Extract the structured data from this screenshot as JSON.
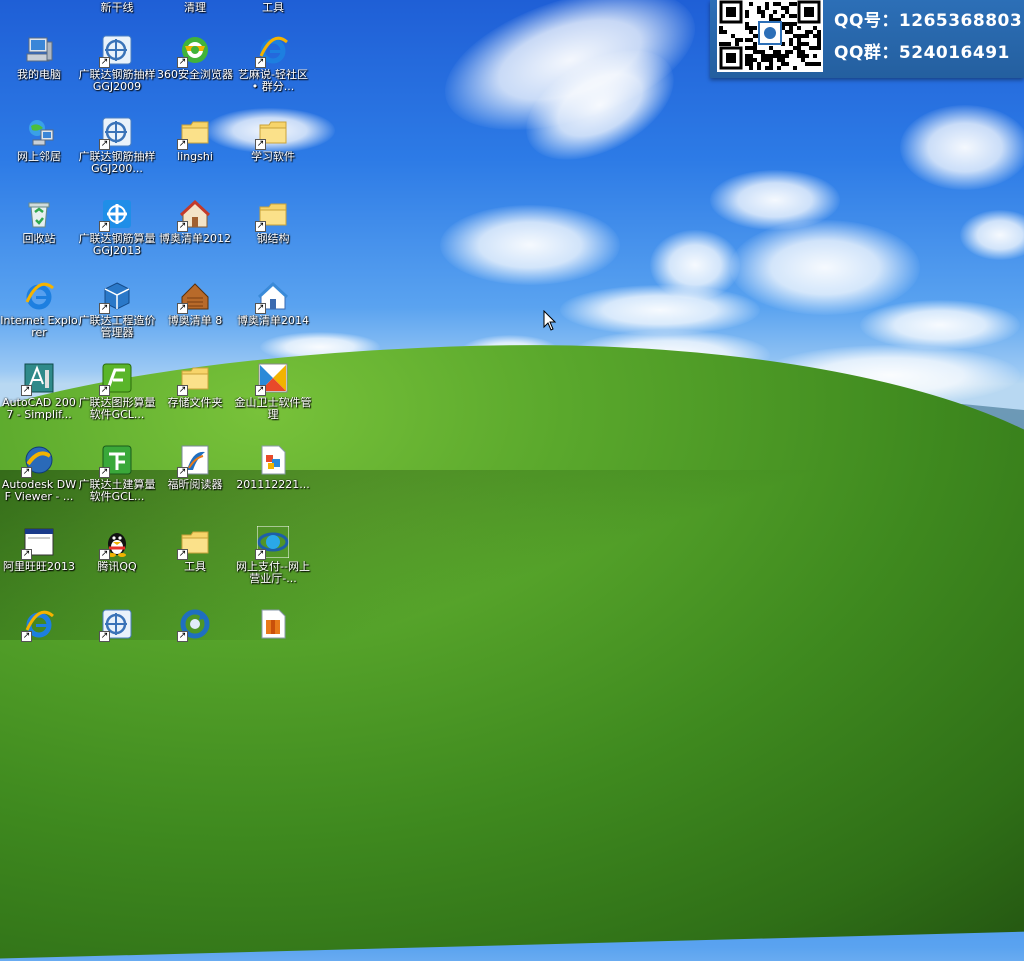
{
  "desktop": {
    "top_partial_labels": [
      "新干线",
      "清理",
      "工具"
    ],
    "icons": [
      {
        "label": "我的电脑",
        "icon": "my-computer-icon",
        "shortcut": false
      },
      {
        "label": "广联达钢筋抽样 GGJ2009",
        "icon": "ggj-icon",
        "shortcut": true
      },
      {
        "label": "360安全浏览器",
        "icon": "browser-360-icon",
        "shortcut": true
      },
      {
        "label": "艺麻说-轻社区 • 群分...",
        "icon": "ie-icon",
        "shortcut": true
      },
      {
        "label": "网上邻居",
        "icon": "network-icon",
        "shortcut": false
      },
      {
        "label": "广联达钢筋抽样 GGJ200...",
        "icon": "ggj-icon",
        "shortcut": true
      },
      {
        "label": "lingshi",
        "icon": "folder-icon",
        "shortcut": true
      },
      {
        "label": "学习软件",
        "icon": "folder-icon",
        "shortcut": true
      },
      {
        "label": "回收站",
        "icon": "recycle-bin-icon",
        "shortcut": false
      },
      {
        "label": "广联达钢筋算量 GGJ2013",
        "icon": "ggj2013-icon",
        "shortcut": true
      },
      {
        "label": "博奥清单2012",
        "icon": "house-icon",
        "shortcut": true
      },
      {
        "label": "钢结构",
        "icon": "folder-icon",
        "shortcut": true
      },
      {
        "label": "Internet Explorer",
        "icon": "ie-icon",
        "shortcut": false
      },
      {
        "label": "广联达工程造价管理器",
        "icon": "gcl-cube-icon",
        "shortcut": true
      },
      {
        "label": "博奥清单 8",
        "icon": "house-brown-icon",
        "shortcut": true
      },
      {
        "label": "博奥清单2014",
        "icon": "house-blue-icon",
        "shortcut": true
      },
      {
        "label": "AutoCAD 2007 - Simplif...",
        "icon": "autocad-icon",
        "shortcut": true
      },
      {
        "label": "广联达图形算量软件GCL...",
        "icon": "gcl-green-icon",
        "shortcut": true
      },
      {
        "label": "存储文件夹",
        "icon": "folder-icon",
        "shortcut": true
      },
      {
        "label": "金山卫士软件管理",
        "icon": "kingsoft-icon",
        "shortcut": true
      },
      {
        "label": "Autodesk DWF Viewer - ...",
        "icon": "dwf-viewer-icon",
        "shortcut": true
      },
      {
        "label": "广联达土建算量软件GCL...",
        "icon": "gcl-tujian-icon",
        "shortcut": true
      },
      {
        "label": "福昕阅读器",
        "icon": "foxit-icon",
        "shortcut": true
      },
      {
        "label": "201112221...",
        "icon": "image-file-icon",
        "shortcut": false
      },
      {
        "label": "阿里旺旺2013",
        "icon": "window-app-icon",
        "shortcut": true
      },
      {
        "label": "腾讯QQ",
        "icon": "qq-penguin-icon",
        "shortcut": true
      },
      {
        "label": "工具",
        "icon": "folder-icon",
        "shortcut": true
      },
      {
        "label": "网上支付--网上营业厅-...",
        "icon": "ie-ring-icon",
        "shortcut": true
      },
      {
        "label": "",
        "icon": "ie-icon",
        "shortcut": true
      },
      {
        "label": "",
        "icon": "ggj-icon",
        "shortcut": true
      },
      {
        "label": "",
        "icon": "sync-icon",
        "shortcut": true
      },
      {
        "label": "",
        "icon": "package-icon",
        "shortcut": false
      }
    ]
  },
  "qq_panel": {
    "qq_label": "QQ号：",
    "qq_number": "1265368803",
    "group_label": "QQ群：",
    "group_number": "524016491"
  },
  "colors": {
    "sky_top": "#1f5fd6",
    "hill": "#5aa82c",
    "panel_bg": "#2c6fb7"
  }
}
